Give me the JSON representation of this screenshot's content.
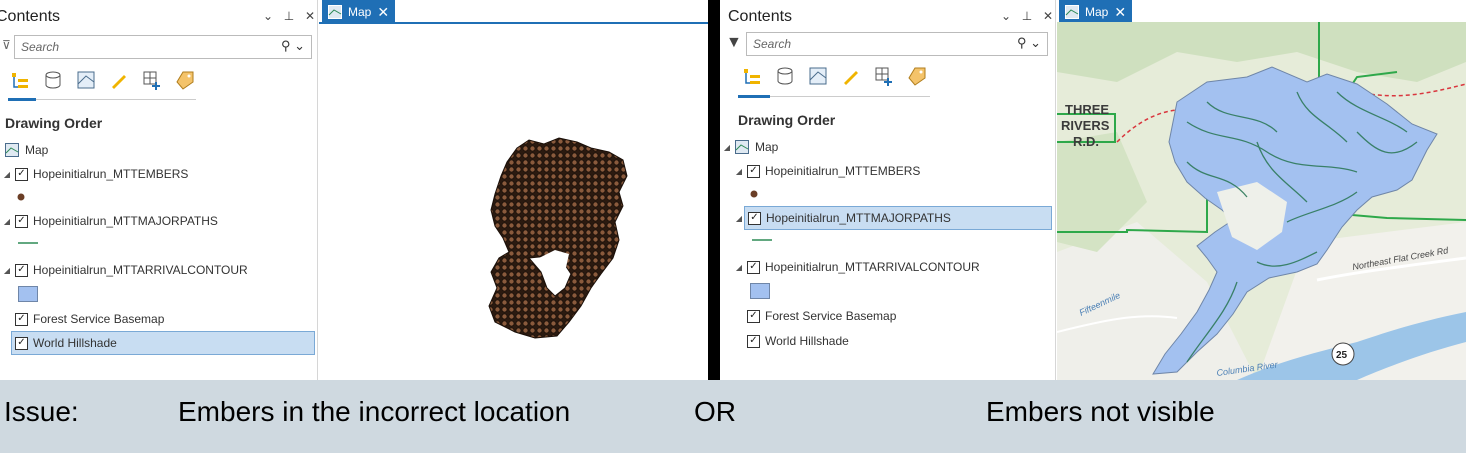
{
  "left": {
    "pane_title": "Contents",
    "search_placeholder": "Search",
    "section_title": "Drawing Order",
    "tab_label": "Map",
    "layers": [
      {
        "label": "Map"
      },
      {
        "label": "Hopeinitialrun_MTTEMBERS",
        "checked": true
      },
      {
        "label": "Hopeinitialrun_MTTMAJORPATHS",
        "checked": true
      },
      {
        "label": "Hopeinitialrun_MTTARRIVALCONTOUR",
        "checked": true
      },
      {
        "label": "Forest Service Basemap",
        "checked": true
      },
      {
        "label": "World Hillshade",
        "checked": true,
        "selected": true
      }
    ]
  },
  "right": {
    "pane_title": "Contents",
    "search_placeholder": "Search",
    "section_title": "Drawing Order",
    "tab_label": "Map",
    "layers": [
      {
        "label": "Map"
      },
      {
        "label": "Hopeinitialrun_MTTEMBERS",
        "checked": true
      },
      {
        "label": "Hopeinitialrun_MTTMAJORPATHS",
        "checked": true,
        "selected": true
      },
      {
        "label": "Hopeinitialrun_MTTARRIVALCONTOUR",
        "checked": true
      },
      {
        "label": "Forest Service Basemap",
        "checked": true
      },
      {
        "label": "World Hillshade",
        "checked": true
      }
    ],
    "map_labels": {
      "district_line1": "THREE",
      "district_line2": "RIVERS",
      "district_line3": "R.D.",
      "road": "Northeast Flat Creek Rd",
      "creek": "Fifteenmile",
      "route_shield": "25",
      "river": "Columbia River"
    }
  },
  "caption": {
    "issue_label": "Issue:",
    "option_a": "Embers in the incorrect location",
    "or_label": "OR",
    "option_b": "Embers not visible"
  },
  "colors": {
    "accent": "#1f6fb5",
    "selection": "#c8ddf2",
    "ember_fill": "#8a5a3c",
    "contour_fill": "#a3c1f0",
    "paths_line": "#2e8b57",
    "forest_boundary": "#2ea84a",
    "background_caption": "#cfd9e0"
  }
}
